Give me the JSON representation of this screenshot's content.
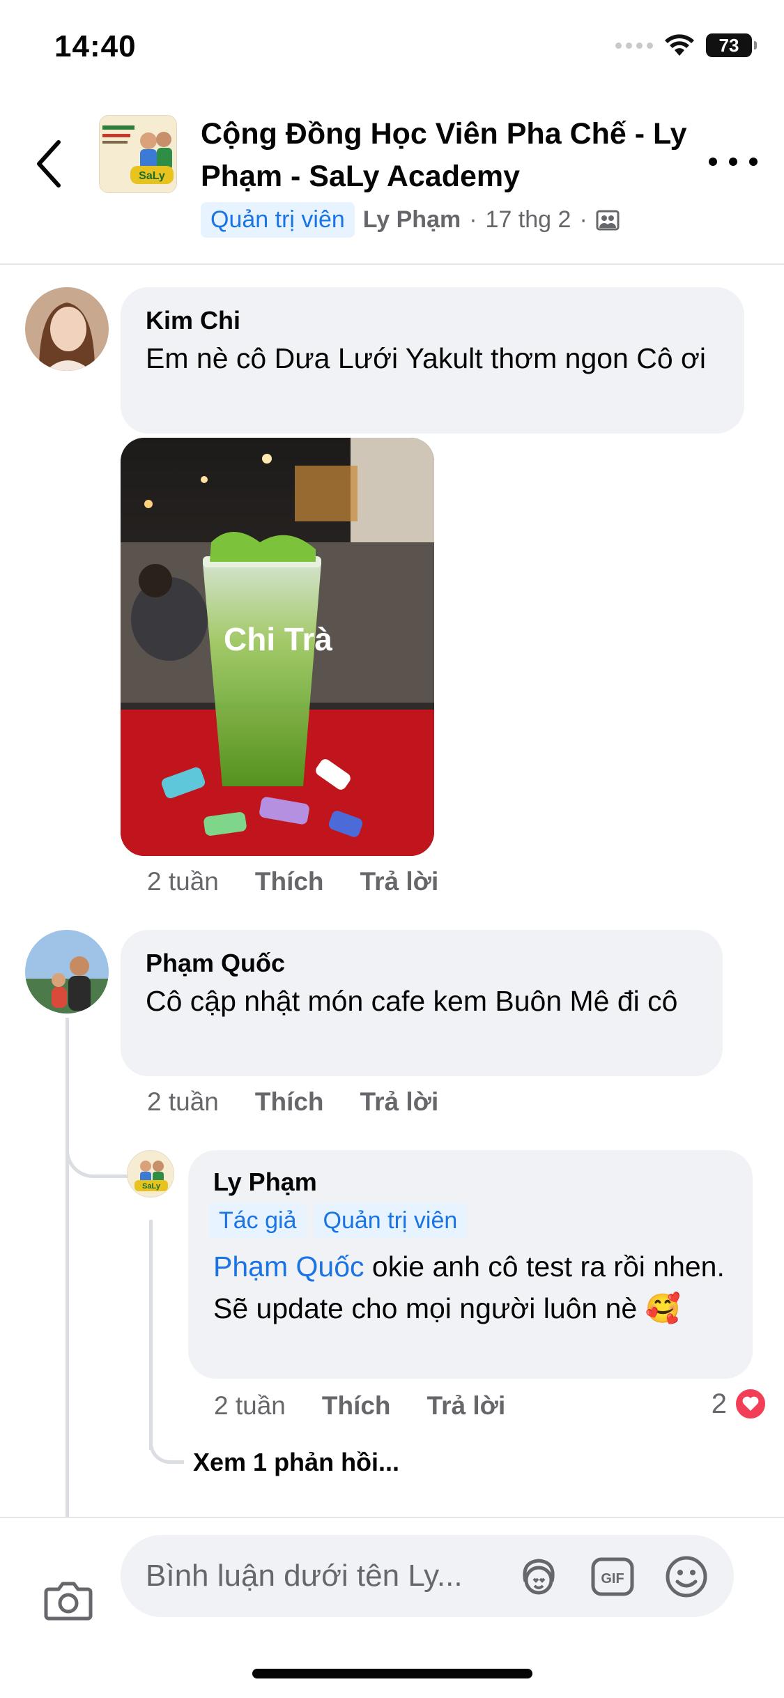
{
  "status_bar": {
    "time": "14:40",
    "battery": "73"
  },
  "header": {
    "group_name": "Cộng Đồng Học Viên Pha Chế - Ly Phạm - SaLy Academy",
    "admin_badge": "Quản trị viên",
    "author": "Ly Phạm",
    "date": "17 thg 2",
    "separator": "·"
  },
  "comments": [
    {
      "author": "Kim Chi",
      "text": "Em nè cô Dưa Lưới Yakult thơm ngon Cô ơi",
      "time": "2 tuần",
      "like_label": "Thích",
      "reply_label": "Trả lời"
    },
    {
      "author": "Phạm Quốc",
      "text": "Cô cập nhật món cafe kem Buôn Mê đi cô",
      "time": "2 tuần",
      "like_label": "Thích",
      "reply_label": "Trả lời"
    }
  ],
  "reply": {
    "author": "Ly Phạm",
    "badges": [
      "Tác giả",
      "Quản trị viên"
    ],
    "mention": "Phạm Quốc",
    "text": " okie anh cô test ra rồi nhen. Sẽ update cho mọi người luôn nè 🥰",
    "time": "2 tuần",
    "like_label": "Thích",
    "reply_label": "Trả lời",
    "reaction_count": "2"
  },
  "see_replies": "Xem 1 phản hồi...",
  "composer": {
    "placeholder": "Bình luận dưới tên Ly..."
  },
  "colors": {
    "accent": "#1b74e4",
    "bubble": "#f0f2f5",
    "heart": "#f33e58"
  }
}
